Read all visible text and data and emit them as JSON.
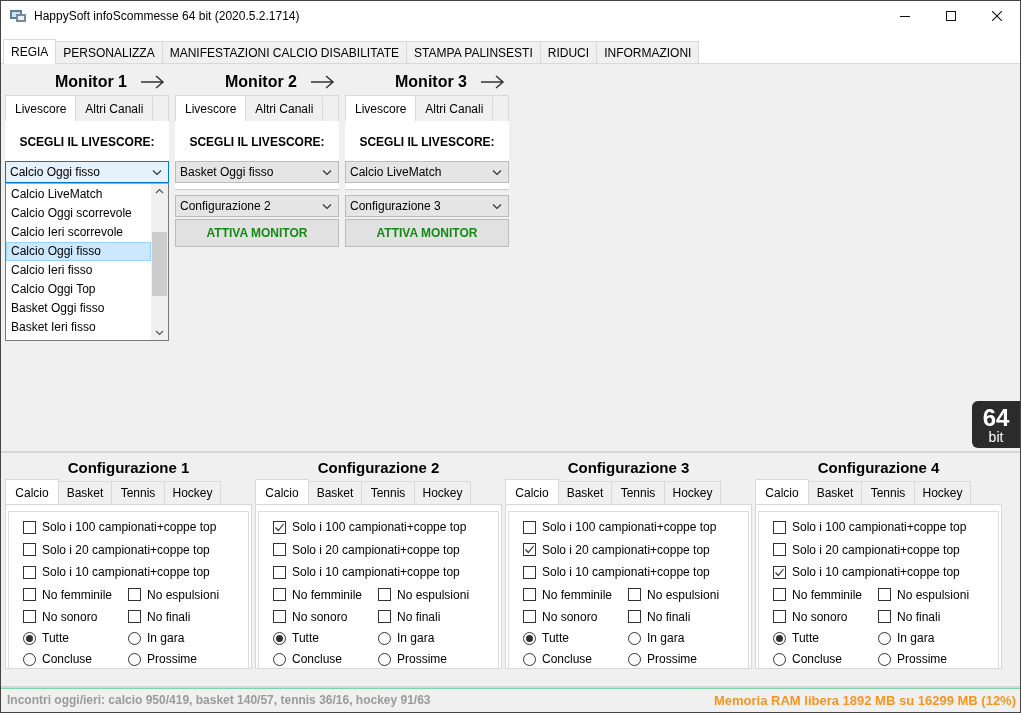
{
  "window": {
    "title": "HappySoft infoScommesse 64 bit (2020.5.2.1714)"
  },
  "tabs": [
    {
      "label": "REGIA",
      "selected": true
    },
    {
      "label": "PERSONALIZZA",
      "selected": false
    },
    {
      "label": "MANIFESTAZIONI CALCIO DISABILITATE",
      "selected": false
    },
    {
      "label": "STAMPA PALINSESTI",
      "selected": false
    },
    {
      "label": "RIDUCI",
      "selected": false
    },
    {
      "label": "INFORMAZIONI",
      "selected": false
    }
  ],
  "monitors": [
    {
      "title": "Monitor 1",
      "tabs": [
        {
          "label": "Livescore",
          "selected": true
        },
        {
          "label": "Altri Canali",
          "selected": false
        }
      ],
      "heading": "SCEGLI IL LIVESCORE:",
      "livescore": {
        "value": "Calcio Oggi fisso",
        "open": true
      },
      "dropdown_list": {
        "items": [
          {
            "label": "Calcio LiveMatch",
            "selected": false
          },
          {
            "label": "Calcio Oggi scorrevole",
            "selected": false
          },
          {
            "label": "Calcio Ieri scorrevole",
            "selected": false
          },
          {
            "label": "Calcio Oggi fisso",
            "selected": true
          },
          {
            "label": "Calcio Ieri fisso",
            "selected": false
          },
          {
            "label": "Calcio Oggi Top",
            "selected": false
          },
          {
            "label": "Basket Oggi fisso",
            "selected": false
          },
          {
            "label": "Basket Ieri fisso",
            "selected": false
          }
        ]
      }
    },
    {
      "title": "Monitor 2",
      "tabs": [
        {
          "label": "Livescore",
          "selected": true
        },
        {
          "label": "Altri Canali",
          "selected": false
        }
      ],
      "heading": "SCEGLI IL LIVESCORE:",
      "livescore": {
        "value": "Basket Oggi fisso",
        "open": false
      },
      "configuration": "Configurazione 2",
      "button": "ATTIVA MONITOR"
    },
    {
      "title": "Monitor 3",
      "tabs": [
        {
          "label": "Livescore",
          "selected": true
        },
        {
          "label": "Altri Canali",
          "selected": false
        }
      ],
      "heading": "SCEGLI IL LIVESCORE:",
      "livescore": {
        "value": "Calcio LiveMatch",
        "open": false
      },
      "configuration": "Configurazione 3",
      "button": "ATTIVA MONITOR"
    }
  ],
  "badge": {
    "number": "64",
    "unit": "bit"
  },
  "configurations": [
    {
      "title": "Configurazione 1",
      "tabs": [
        {
          "label": "Calcio",
          "selected": true
        },
        {
          "label": "Basket",
          "selected": false
        },
        {
          "label": "Tennis",
          "selected": false
        },
        {
          "label": "Hockey",
          "selected": false
        }
      ],
      "top_options": [
        {
          "label": "Solo i 100 campionati+coppe top",
          "checked": false
        },
        {
          "label": "Solo i 20 campionati+coppe top",
          "checked": false
        },
        {
          "label": "Solo i 10 campionati+coppe top",
          "checked": false
        }
      ],
      "filters": [
        {
          "label": "No femminile",
          "checked": false
        },
        {
          "label": "No espulsioni",
          "checked": false
        },
        {
          "label": "No sonoro",
          "checked": false
        },
        {
          "label": "No finali",
          "checked": false
        }
      ],
      "view": [
        {
          "label": "Tutte",
          "selected": true
        },
        {
          "label": "In gara",
          "selected": false
        },
        {
          "label": "Concluse",
          "selected": false
        },
        {
          "label": "Prossime",
          "selected": false
        }
      ]
    },
    {
      "title": "Configurazione 2",
      "tabs": [
        {
          "label": "Calcio",
          "selected": true
        },
        {
          "label": "Basket",
          "selected": false
        },
        {
          "label": "Tennis",
          "selected": false
        },
        {
          "label": "Hockey",
          "selected": false
        }
      ],
      "top_options": [
        {
          "label": "Solo i 100 campionati+coppe top",
          "checked": true
        },
        {
          "label": "Solo i 20 campionati+coppe top",
          "checked": false
        },
        {
          "label": "Solo i 10 campionati+coppe top",
          "checked": false
        }
      ],
      "filters": [
        {
          "label": "No femminile",
          "checked": false
        },
        {
          "label": "No espulsioni",
          "checked": false
        },
        {
          "label": "No sonoro",
          "checked": false
        },
        {
          "label": "No finali",
          "checked": false
        }
      ],
      "view": [
        {
          "label": "Tutte",
          "selected": true
        },
        {
          "label": "In gara",
          "selected": false
        },
        {
          "label": "Concluse",
          "selected": false
        },
        {
          "label": "Prossime",
          "selected": false
        }
      ]
    },
    {
      "title": "Configurazione 3",
      "tabs": [
        {
          "label": "Calcio",
          "selected": true
        },
        {
          "label": "Basket",
          "selected": false
        },
        {
          "label": "Tennis",
          "selected": false
        },
        {
          "label": "Hockey",
          "selected": false
        }
      ],
      "top_options": [
        {
          "label": "Solo i 100 campionati+coppe top",
          "checked": false
        },
        {
          "label": "Solo i 20 campionati+coppe top",
          "checked": true
        },
        {
          "label": "Solo i 10 campionati+coppe top",
          "checked": false
        }
      ],
      "filters": [
        {
          "label": "No femminile",
          "checked": false
        },
        {
          "label": "No espulsioni",
          "checked": false
        },
        {
          "label": "No sonoro",
          "checked": false
        },
        {
          "label": "No finali",
          "checked": false
        }
      ],
      "view": [
        {
          "label": "Tutte",
          "selected": true
        },
        {
          "label": "In gara",
          "selected": false
        },
        {
          "label": "Concluse",
          "selected": false
        },
        {
          "label": "Prossime",
          "selected": false
        }
      ]
    },
    {
      "title": "Configurazione 4",
      "tabs": [
        {
          "label": "Calcio",
          "selected": true
        },
        {
          "label": "Basket",
          "selected": false
        },
        {
          "label": "Tennis",
          "selected": false
        },
        {
          "label": "Hockey",
          "selected": false
        }
      ],
      "top_options": [
        {
          "label": "Solo i 100 campionati+coppe top",
          "checked": false
        },
        {
          "label": "Solo i 20 campionati+coppe top",
          "checked": false
        },
        {
          "label": "Solo i 10 campionati+coppe top",
          "checked": true
        }
      ],
      "filters": [
        {
          "label": "No femminile",
          "checked": false
        },
        {
          "label": "No espulsioni",
          "checked": false
        },
        {
          "label": "No sonoro",
          "checked": false
        },
        {
          "label": "No finali",
          "checked": false
        }
      ],
      "view": [
        {
          "label": "Tutte",
          "selected": true
        },
        {
          "label": "In gara",
          "selected": false
        },
        {
          "label": "Concluse",
          "selected": false
        },
        {
          "label": "Prossime",
          "selected": false
        }
      ]
    }
  ],
  "status_bar": {
    "counts": "Incontri oggi/ieri: calcio 950/419, basket 140/57, tennis 36/16, hockey 91/63",
    "memory": "Memoria RAM libera 1892 MB su 16299 MB (12%)"
  }
}
